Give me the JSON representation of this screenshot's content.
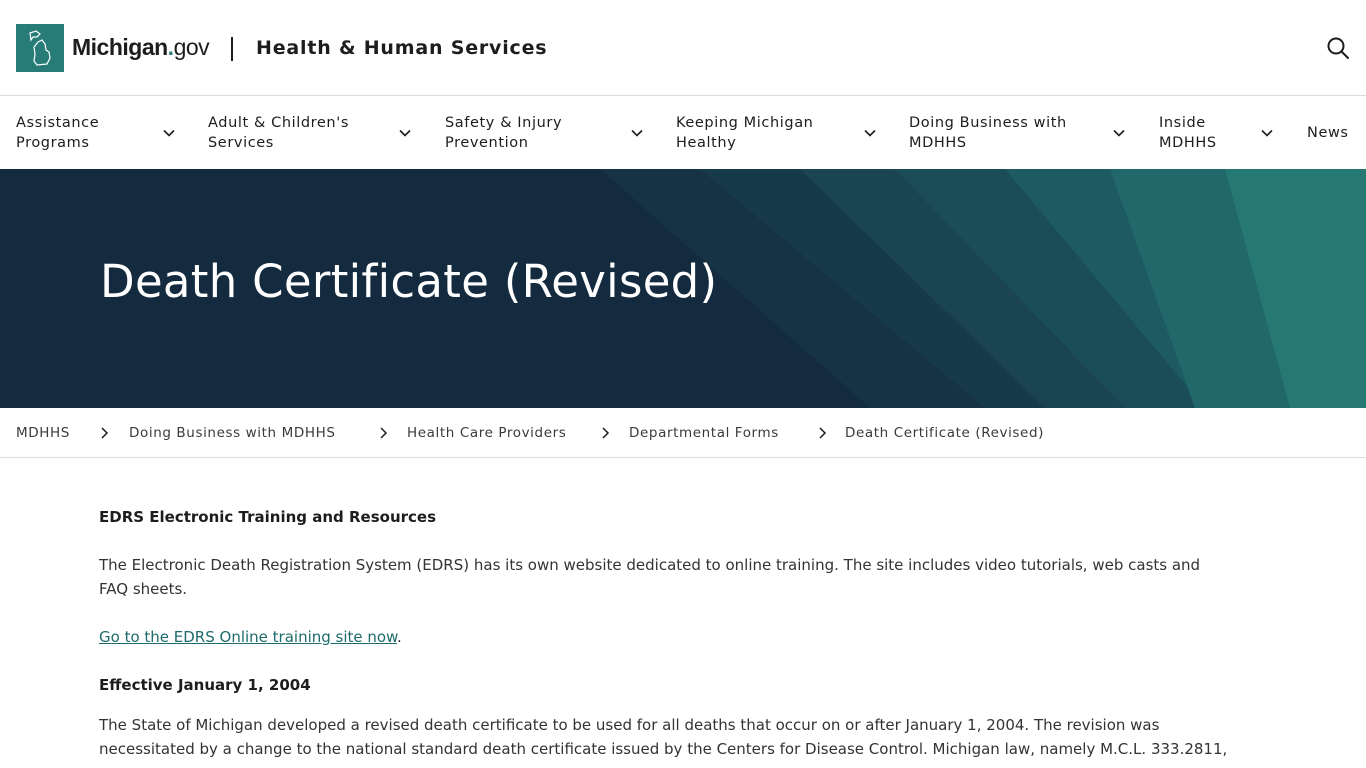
{
  "header": {
    "logo_word_bold": "Michigan",
    "logo_word_dot": ".",
    "logo_word_gov": "gov",
    "department": "Health & Human Services",
    "search_icon": "search-icon"
  },
  "nav": {
    "items": [
      {
        "label": "Assistance Programs",
        "has_dropdown": true
      },
      {
        "label": "Adult & Children's Services",
        "has_dropdown": true
      },
      {
        "label": "Safety & Injury Prevention",
        "has_dropdown": true
      },
      {
        "label": "Keeping Michigan Healthy",
        "has_dropdown": true
      },
      {
        "label": "Doing Business with MDHHS",
        "has_dropdown": true
      },
      {
        "label": "Inside MDHHS",
        "has_dropdown": true
      },
      {
        "label": "News",
        "has_dropdown": false
      }
    ]
  },
  "hero": {
    "title": "Death Certificate (Revised)"
  },
  "breadcrumb": {
    "items": [
      "MDHHS",
      "Doing Business with MDHHS",
      "Health Care Providers",
      "Departmental Forms",
      "Death Certificate (Revised)"
    ]
  },
  "content": {
    "heading1": "EDRS Electronic Training and Resources",
    "para1_line1": "The Electronic Death Registration System (EDRS) has its own website dedicated to online training. The site includes video tutorials, web casts and",
    "para1_line2": "FAQ sheets.",
    "link_text": "Go to the EDRS Online training site now",
    "link_suffix": ".",
    "heading2": "Effective January 1, 2004",
    "para2_line1": "The State of Michigan developed a revised death certificate to be used for all deaths that occur on or after January 1, 2004. The revision was",
    "para2_line2": "necessitated by a change to the national standard death certificate issued by the Centers for Disease Control. Michigan law, namely M.C.L. 333.2811,"
  },
  "colors": {
    "brand_teal": "#277c78",
    "hero_navy": "#142a3e",
    "link": "#1e6b6b"
  }
}
